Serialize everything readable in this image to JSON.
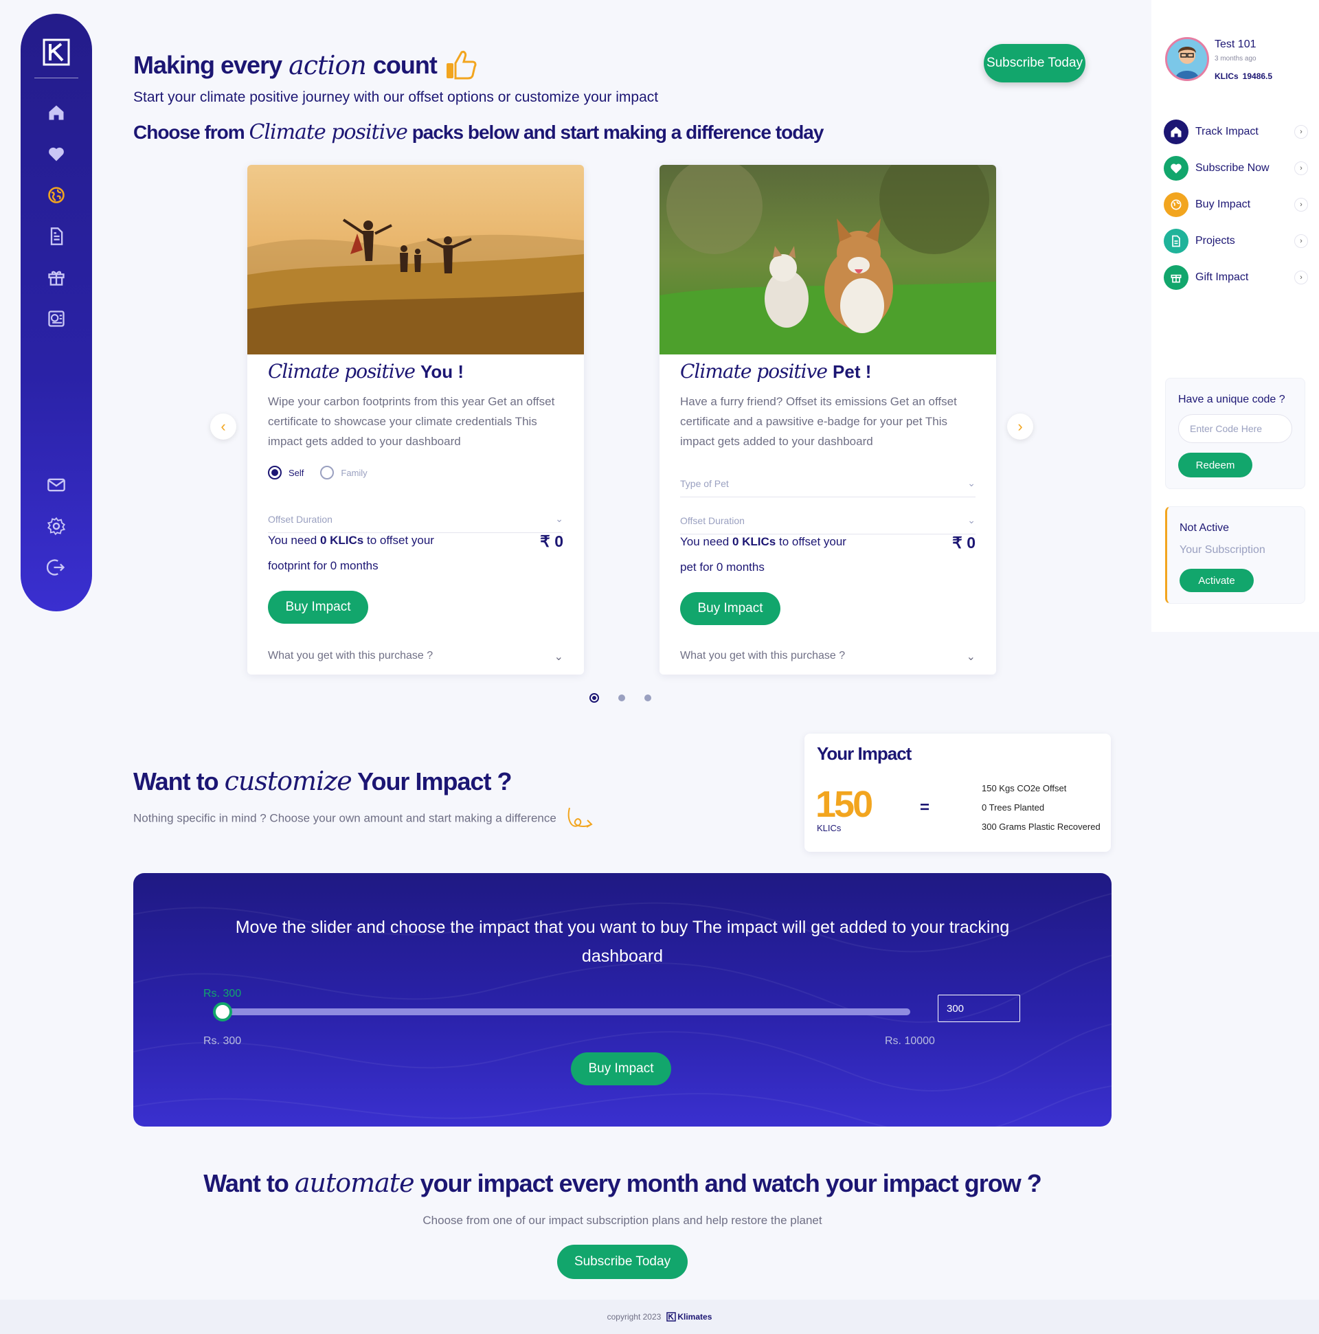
{
  "header": {
    "title_pre": "Making every",
    "title_script": "action",
    "title_post": "count",
    "subtitle": "Start your climate positive journey with our offset options or customize your impact",
    "choose_pre": "Choose from",
    "choose_script": "Climate positive",
    "choose_post": "packs below and start making a difference today",
    "subscribe_label": "Subscribe Today"
  },
  "cards": [
    {
      "script": "Climate positive",
      "title": "You !",
      "description": "Wipe your carbon footprints from this year Get an offset certificate to showcase your climate credentials This impact gets added to your dashboard",
      "radio_self": "Self",
      "radio_family": "Family",
      "duration_placeholder": "Offset Duration",
      "need_pre": "You need",
      "need_klics": "0 KLICs",
      "need_mid": "to offset your",
      "need_post": "footprint for 0 months",
      "price": "₹ 0",
      "buy_label": "Buy Impact",
      "what_label": "What you get with this purchase ?"
    },
    {
      "script": "Climate positive",
      "title": "Pet !",
      "description": "Have a furry friend? Offset its emissions Get an offset certificate and a pawsitive e-badge for your pet This impact gets added to your dashboard",
      "pet_placeholder": "Type of Pet",
      "duration_placeholder": "Offset Duration",
      "need_pre": "You need",
      "need_klics": "0 KLICs",
      "need_mid": "to offset your",
      "need_post": "pet for 0 months",
      "price": "₹ 0",
      "buy_label": "Buy Impact",
      "what_label": "What you get with this purchase ?"
    }
  ],
  "customize": {
    "title_pre": "Want to",
    "title_script": "customize",
    "title_post": "Your Impact ?",
    "subtitle": "Nothing specific in mind ? Choose your own amount and start making a difference"
  },
  "your_impact": {
    "title": "Your Impact",
    "value": "150",
    "unit": "KLICs",
    "equals": "=",
    "line1": "150 Kgs CO2e Offset",
    "line2": "0 Trees Planted",
    "line3": "300 Grams Plastic Recovered"
  },
  "slider": {
    "message": "Move the slider and choose the impact that you want to buy The impact will get added to your tracking dashboard",
    "current_label": "Rs. 300",
    "min_label": "Rs. 300",
    "max_label": "Rs. 10000",
    "input_value": "300",
    "fraction": 0,
    "buy_label": "Buy Impact"
  },
  "automate": {
    "title_pre": "Want to",
    "title_script": "automate",
    "title_post": "your impact every month and watch your impact grow ?",
    "subtitle": "Choose from one of our impact subscription plans and help restore the planet",
    "subscribe_label": "Subscribe Today"
  },
  "footer": {
    "copyright": "copyright 2023",
    "brand": "Klimates"
  },
  "profile": {
    "name": "Test 101",
    "time": "3 months ago",
    "klics_label": "KLICs",
    "klics_value": "19486.5"
  },
  "right_menu": [
    {
      "label": "Track Impact",
      "color": "#1c1673",
      "icon": "home-icon"
    },
    {
      "label": "Subscribe Now",
      "color": "#12a66c",
      "icon": "heart-icon"
    },
    {
      "label": "Buy Impact",
      "color": "#f2a51f",
      "icon": "globe-icon"
    },
    {
      "label": "Projects",
      "color": "#1fb39a",
      "icon": "document-icon"
    },
    {
      "label": "Gift Impact",
      "color": "#12a66c",
      "icon": "gift-icon"
    }
  ],
  "redeem": {
    "question": "Have a unique code ?",
    "placeholder": "Enter Code Here",
    "button": "Redeem"
  },
  "subscription": {
    "status": "Not Active",
    "label": "Your Subscription",
    "button": "Activate"
  },
  "colors": {
    "navy": "#1c1673",
    "green": "#12a66c",
    "orange": "#f2a51f"
  }
}
